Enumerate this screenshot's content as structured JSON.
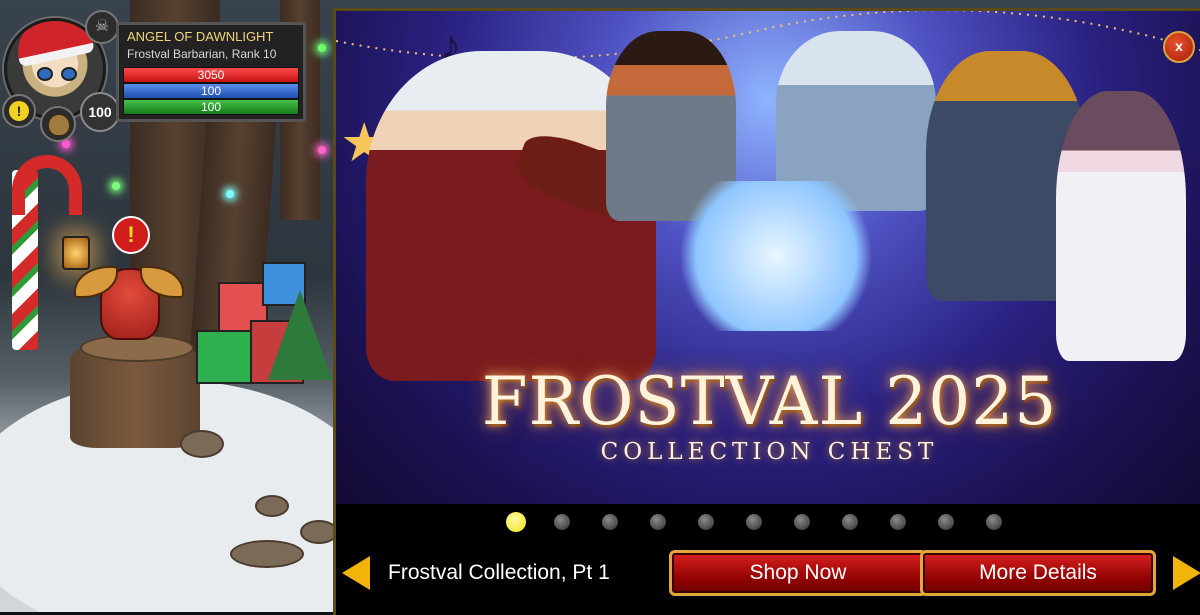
{
  "player": {
    "name": "ANGEL OF DAWNLIGHT",
    "class_rank": "Frostval Barbarian, Rank 10",
    "hp": "3050",
    "mp": "100",
    "sp": "100",
    "level": "100",
    "alert_icon": "!",
    "skull_icon": "☠"
  },
  "promo": {
    "title": "FROSTVAL 2025",
    "subtitle": "COLLECTION CHEST",
    "close_icon": "x",
    "slide_label": "Frostval Collection, Pt 1",
    "shop_button": "Shop Now",
    "details_button": "More Details",
    "slide_count": 11,
    "active_slide": 1
  },
  "scene": {
    "npc_alert_icon": "!"
  },
  "colors": {
    "accent_gold": "#f3b40a",
    "button_red": "#b31414",
    "hp": "#e02020",
    "mp": "#3b6fd8",
    "sp": "#2aa02f"
  }
}
